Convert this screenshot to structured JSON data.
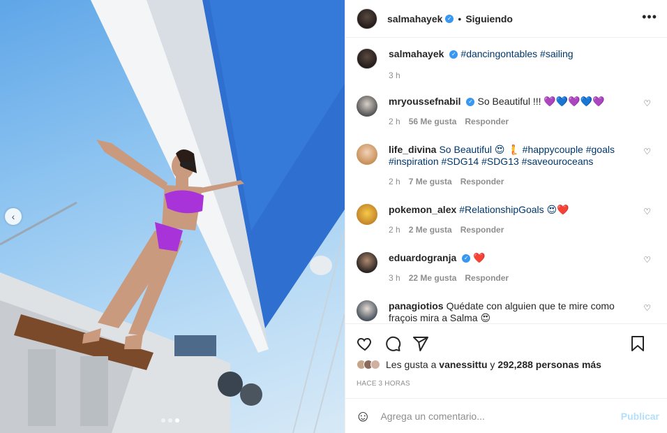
{
  "header": {
    "username": "salmahayek",
    "separator": "•",
    "follow_status": "Siguiendo",
    "more": "•••"
  },
  "caption": {
    "username": "salmahayek",
    "text": "#dancingontables #sailing",
    "time": "3 h"
  },
  "comments": [
    {
      "username": "mryoussefnabil",
      "verified": true,
      "text": "So Beautiful !!! 💜💙💜💙💜",
      "time": "2 h",
      "likes": "56 Me gusta",
      "reply": "Responder"
    },
    {
      "username": "life_divina",
      "verified": false,
      "text": "So Beautiful 😍 🧜 #happycouple #goals #inspiration #SDG14 #SDG13 #saveouroceans",
      "time": "2 h",
      "likes": "7 Me gusta",
      "reply": "Responder"
    },
    {
      "username": "pokemon_alex",
      "verified": false,
      "text": "#RelationshipGoals 😍❤️",
      "time": "2 h",
      "likes": "2 Me gusta",
      "reply": "Responder"
    },
    {
      "username": "eduardogranja",
      "verified": true,
      "text": "❤️",
      "time": "3 h",
      "likes": "22 Me gusta",
      "reply": "Responder"
    },
    {
      "username": "panagiotios",
      "verified": false,
      "text": "Quédate con alguien que te mire como fraçois mira a Salma 😍",
      "time": "",
      "likes": "",
      "reply": ""
    }
  ],
  "likes": {
    "prefix": "Les gusta a",
    "user": "vanessittu",
    "joiner": "y",
    "count": "292,288 personas más"
  },
  "time_ago": "HACE 3 HORAS",
  "add_comment": {
    "placeholder": "Agrega un comentario...",
    "publish": "Publicar"
  },
  "photo": {
    "prev": "‹",
    "slides": 3,
    "active_slide": 3
  },
  "icons": {
    "like": "heart-icon",
    "comment": "comment-icon",
    "share": "share-icon",
    "save": "bookmark-icon",
    "emoji": "smile-icon"
  }
}
